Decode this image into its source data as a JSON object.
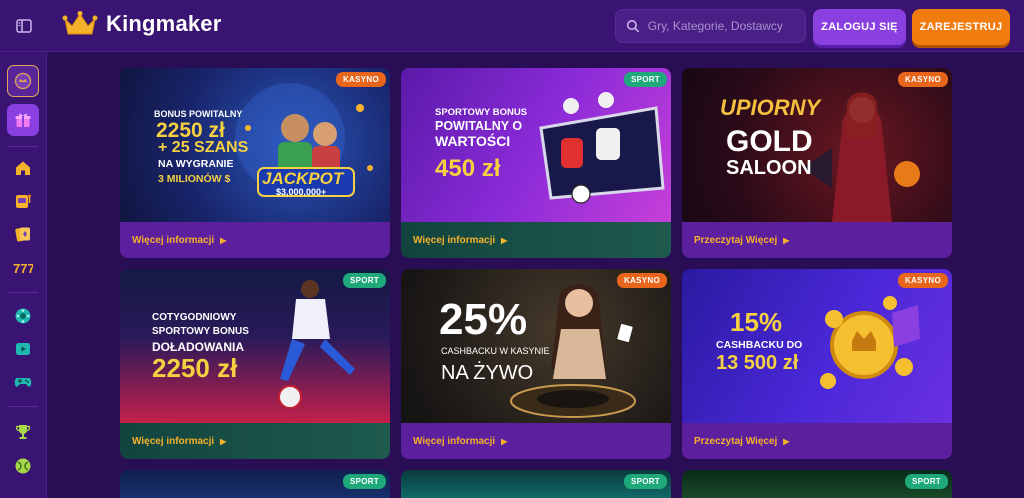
{
  "header": {
    "logo_text": "Kingmaker",
    "search_placeholder": "Gry, Kategorie, Dostawcy",
    "login_label": "ZALOGUJ SIĘ",
    "register_label": "ZAREJESTRUJ"
  },
  "sidebar": {
    "items": [
      "menu-icon",
      "kingmaker-coin-icon",
      "gift-icon",
      "home-icon",
      "slot-machine-icon",
      "live-cards-icon",
      "lucky-777-icon",
      "gameshow-icon",
      "video-icon",
      "gamepad-icon",
      "trophy-icon",
      "sport-icon"
    ]
  },
  "cards": [
    {
      "badge": "KASYNO",
      "footer": "Więcej informacji",
      "lines": [
        "BONUS POWITALNY",
        "2250 zł",
        "+ 25 SZANS",
        "NA WYGRANIE",
        "3 MILIONÓW $"
      ],
      "jackpot": "JACKPOT",
      "jackpot_amount": "$3,000,000+"
    },
    {
      "badge": "SPORT",
      "footer": "Więcej informacji",
      "lines": [
        "SPORTOWY BONUS",
        "POWITALNY O",
        "WARTOŚCI",
        "450 zł"
      ]
    },
    {
      "badge": "KASYNO",
      "footer": "Przeczytaj Więcej",
      "lines": [
        "UPIORNY",
        "GOLD",
        "SALOON"
      ]
    },
    {
      "badge": "SPORT",
      "footer": "Więcej informacji",
      "lines": [
        "COTYGODNIOWY",
        "SPORTOWY BONUS",
        "DOŁADOWANIA",
        "2250 zł"
      ]
    },
    {
      "badge": "KASYNO",
      "footer": "Więcej informacji",
      "lines": [
        "25%",
        "CASHBACKU W KASYNIE",
        "NA ŻYWO"
      ]
    },
    {
      "badge": "KASYNO",
      "footer": "Przeczytaj Więcej",
      "lines": [
        "15%",
        "CASHBACKU DO",
        "13 500 zł"
      ]
    },
    {
      "badge": "SPORT"
    },
    {
      "badge": "SPORT"
    },
    {
      "badge": "SPORT"
    }
  ],
  "colors": {
    "background": "#2a0e55",
    "header": "#3a1472",
    "accent_gold": "#f5b22a",
    "login": "#8a3fe0",
    "register": "#f07c10",
    "badge_kasyno": "#e8651c",
    "badge_sport": "#1fa87a"
  }
}
